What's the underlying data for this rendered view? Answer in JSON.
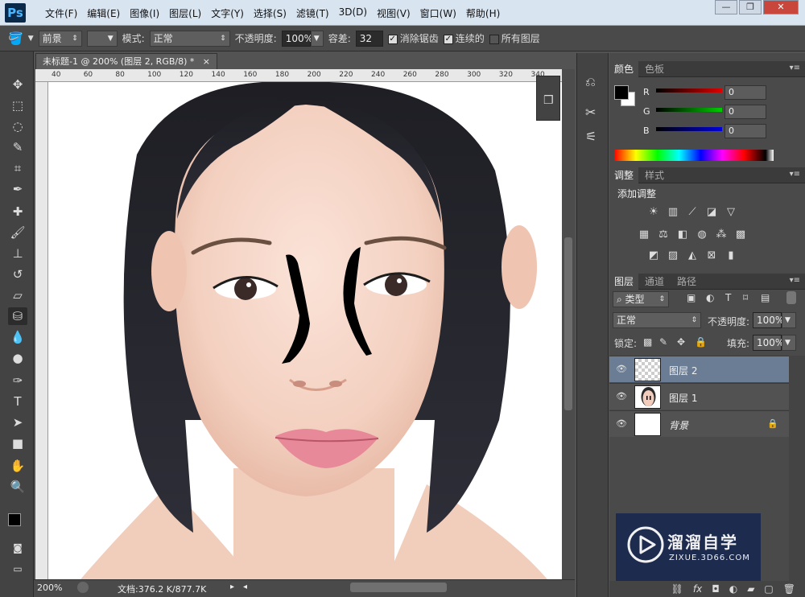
{
  "app": {
    "logo": "Ps"
  },
  "menu": [
    "文件(F)",
    "编辑(E)",
    "图像(I)",
    "图层(L)",
    "文字(Y)",
    "选择(S)",
    "滤镜(T)",
    "3D(D)",
    "视图(V)",
    "窗口(W)",
    "帮助(H)"
  ],
  "window_buttons": {
    "minimize": "—",
    "restore": "❐",
    "close": "✕"
  },
  "options": {
    "fill_source": "前景",
    "mode_label": "模式:",
    "mode_value": "正常",
    "opacity_label": "不透明度:",
    "opacity_value": "100%",
    "tolerance_label": "容差:",
    "tolerance_value": "32",
    "antialias_label": "消除锯齿",
    "antialias_checked": true,
    "contiguous_label": "连续的",
    "contiguous_checked": true,
    "all_layers_label": "所有图层",
    "all_layers_checked": false
  },
  "document": {
    "tab_title": "未标题-1 @ 200% (图层 2, RGB/8) *",
    "ruler_ticks": [
      "40",
      "60",
      "80",
      "100",
      "120",
      "140",
      "160",
      "180",
      "200",
      "220",
      "240",
      "260",
      "280",
      "300",
      "320",
      "340"
    ],
    "zoom": "200%",
    "doc_info": "文档:376.2 K/877.7K"
  },
  "color_panel": {
    "tabs": [
      "颜色",
      "色板"
    ],
    "channels": [
      {
        "label": "R",
        "value": "0",
        "color": "#c81414"
      },
      {
        "label": "G",
        "value": "0",
        "color": "#14b414"
      },
      {
        "label": "B",
        "value": "0",
        "color": "#1414c8"
      }
    ],
    "foreground": "#000000",
    "background": "#ffffff"
  },
  "adjust_panel": {
    "tabs": [
      "调整",
      "样式"
    ],
    "title": "添加调整"
  },
  "layers_panel": {
    "tabs": [
      "图层",
      "通道",
      "路径"
    ],
    "filter_kind": "类型",
    "blend_mode": "正常",
    "opacity_label": "不透明度:",
    "opacity_value": "100%",
    "lock_label": "锁定:",
    "fill_label": "填充:",
    "fill_value": "100%",
    "layers": [
      {
        "name": "图层 2",
        "selected": true,
        "thumb": "transparent"
      },
      {
        "name": "图层 1",
        "selected": false,
        "thumb": "face"
      },
      {
        "name": "背景",
        "selected": false,
        "thumb": "white",
        "locked": true
      }
    ]
  },
  "watermark": {
    "brand": "溜溜自学",
    "url": "ZIXUE.3D66.COM"
  }
}
